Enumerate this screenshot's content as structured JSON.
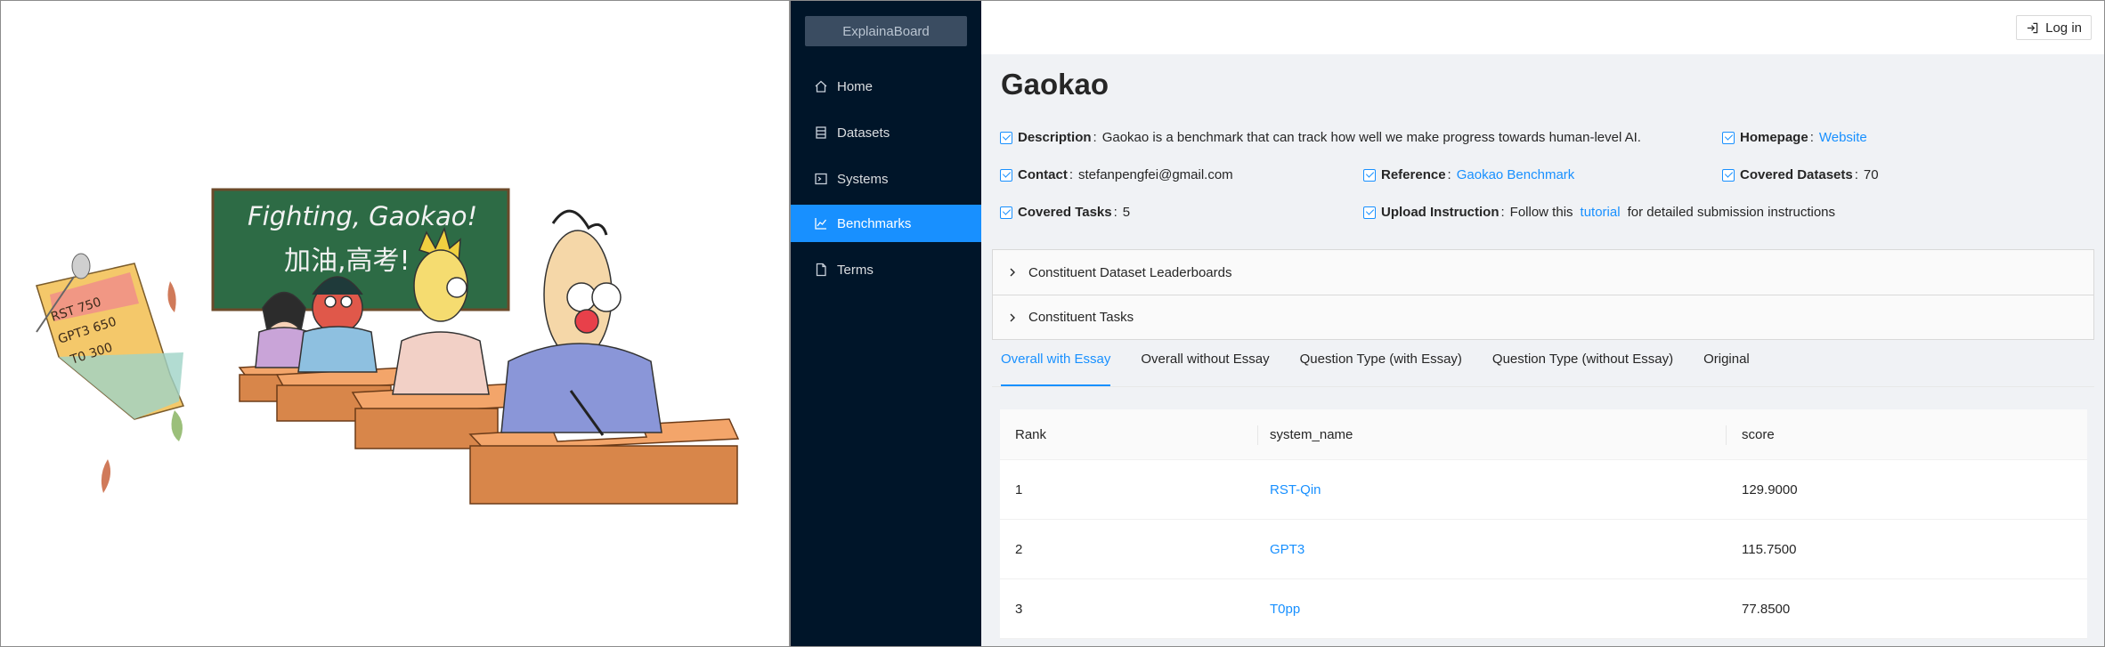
{
  "illustration": {
    "blackboard_line1": "Fighting, Gaokao!",
    "blackboard_line2": "加油,高考!",
    "paper_lines": [
      "RST 750",
      "GPT3 650",
      "T0 300"
    ]
  },
  "sidebar": {
    "brand": "ExplainaBoard",
    "items": [
      {
        "label": "Home",
        "icon": "home-icon"
      },
      {
        "label": "Datasets",
        "icon": "database-icon"
      },
      {
        "label": "Systems",
        "icon": "terminal-icon"
      },
      {
        "label": "Benchmarks",
        "icon": "line-chart-icon",
        "active": true
      },
      {
        "label": "Terms",
        "icon": "file-icon"
      }
    ]
  },
  "header": {
    "login_label": "Log in"
  },
  "benchmark": {
    "title": "Gaokao",
    "description_label": "Description",
    "description": "Gaokao is a benchmark that can track how well we make progress towards human-level AI.",
    "homepage_label": "Homepage",
    "homepage_link": "Website",
    "contact_label": "Contact",
    "contact": "stefanpengfei@gmail.com",
    "reference_label": "Reference",
    "reference_link": "Gaokao Benchmark",
    "covered_datasets_label": "Covered Datasets",
    "covered_datasets": "70",
    "covered_tasks_label": "Covered Tasks",
    "covered_tasks": "5",
    "upload_label": "Upload Instruction",
    "upload_pre": "Follow this",
    "upload_link": "tutorial",
    "upload_post": "for detailed submission instructions",
    "colon": ":"
  },
  "collapse": [
    "Constituent Dataset Leaderboards",
    "Constituent Tasks"
  ],
  "tabs": [
    "Overall with Essay",
    "Overall without Essay",
    "Question Type (with Essay)",
    "Question Type (without Essay)",
    "Original"
  ],
  "table": {
    "headers": [
      "Rank",
      "system_name",
      "score"
    ],
    "rows": [
      {
        "rank": "1",
        "system_name": "RST-Qin",
        "score": "129.9000"
      },
      {
        "rank": "2",
        "system_name": "GPT3",
        "score": "115.7500"
      },
      {
        "rank": "3",
        "system_name": "T0pp",
        "score": "77.8500"
      }
    ]
  },
  "colors": {
    "sidebar_bg": "#001529",
    "accent": "#1890ff",
    "content_bg": "#f0f2f5"
  }
}
